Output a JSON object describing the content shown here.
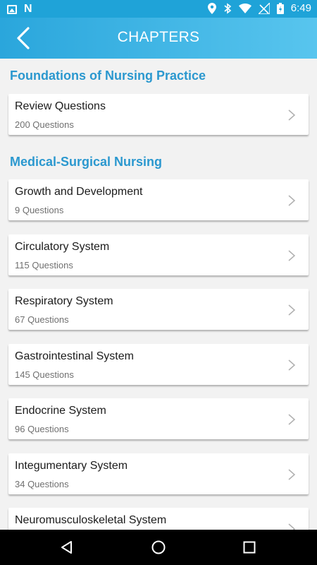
{
  "status_bar": {
    "time": "6:49",
    "icons": [
      "image-icon",
      "n-app-icon",
      "location-icon",
      "bluetooth-icon",
      "wifi-icon",
      "no-signal-icon",
      "battery-charging-icon"
    ]
  },
  "header": {
    "title": "CHAPTERS",
    "back_icon": "chevron-left-icon"
  },
  "sections": [
    {
      "title": "Foundations of Nursing Practice",
      "items": [
        {
          "title": "Review Questions",
          "subtitle": "200 Questions"
        }
      ]
    },
    {
      "title": "Medical-Surgical Nursing",
      "items": [
        {
          "title": "Growth and Development",
          "subtitle": "9 Questions"
        },
        {
          "title": "Circulatory System",
          "subtitle": "115 Questions"
        },
        {
          "title": "Respiratory System",
          "subtitle": "67 Questions"
        },
        {
          "title": "Gastrointestinal System",
          "subtitle": "145 Questions"
        },
        {
          "title": "Endocrine System",
          "subtitle": "96 Questions"
        },
        {
          "title": "Integumentary System",
          "subtitle": "34 Questions"
        },
        {
          "title": "Neuromusculoskeletal System",
          "subtitle": ""
        }
      ]
    }
  ],
  "nav_bar": {
    "buttons": [
      "back-triangle-icon",
      "home-circle-icon",
      "recents-square-icon"
    ]
  },
  "colors": {
    "accent": "#2b98cf",
    "header_gradient_start": "#2aa6dc",
    "header_gradient_end": "#58c5ee",
    "background": "#f2f2f2"
  }
}
